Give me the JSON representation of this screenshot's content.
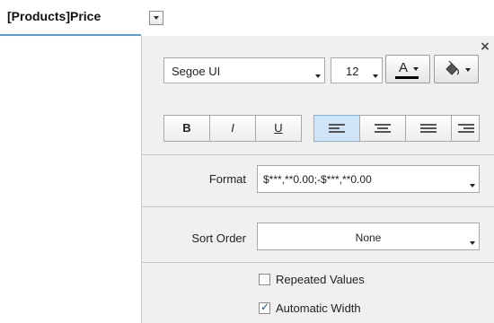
{
  "header": {
    "column_label": "[Products]Price"
  },
  "panel": {
    "font": {
      "family": "Segoe UI",
      "size": "12",
      "font_color_glyph": "A",
      "font_color_swatch": "#000000",
      "fill_icon": "paint-bucket-icon"
    },
    "style_buttons": {
      "bold": "B",
      "italic": "I",
      "underline": "U"
    },
    "alignment": {
      "selected": "align-left"
    },
    "format": {
      "label": "Format",
      "value": "$***,**0.00;-$***,**0.00"
    },
    "sort_order": {
      "label": "Sort Order",
      "value": "None"
    },
    "options": {
      "repeated_values": {
        "label": "Repeated Values",
        "checked": false
      },
      "automatic_width": {
        "label": "Automatic Width",
        "checked": true
      }
    }
  }
}
